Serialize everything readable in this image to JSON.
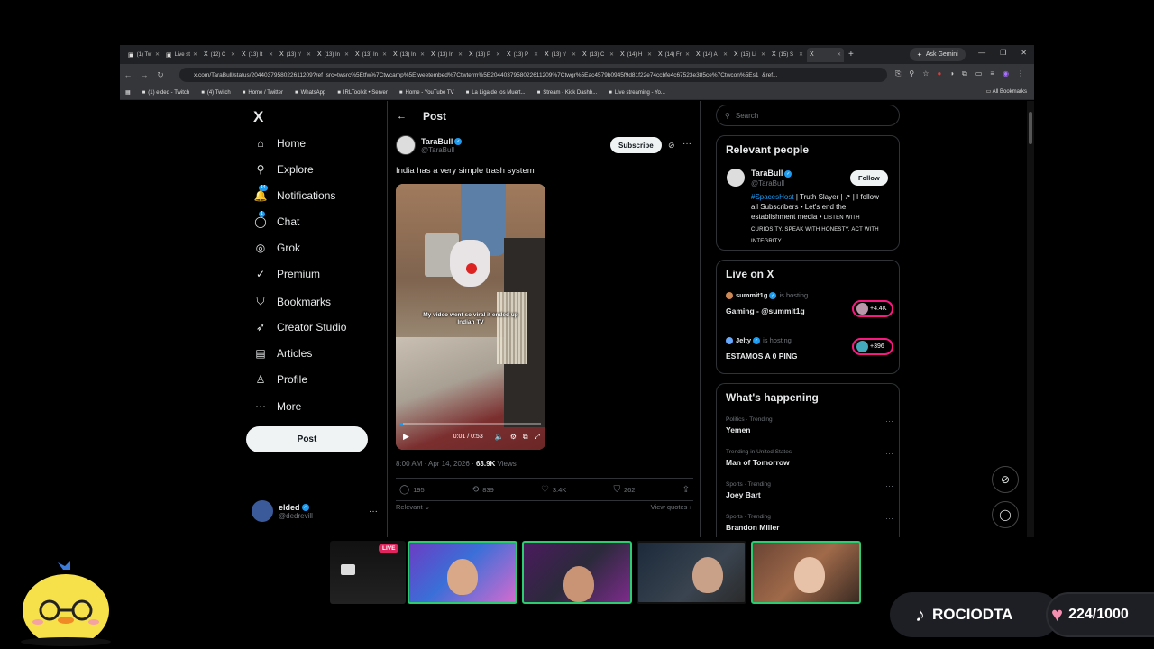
{
  "browser": {
    "tabs": [
      {
        "label": "(1) Tw",
        "active": false
      },
      {
        "label": "Live st",
        "active": false
      },
      {
        "label": "(12) C",
        "active": false
      },
      {
        "label": "(13) It",
        "active": false
      },
      {
        "label": "(13) r/",
        "active": false
      },
      {
        "label": "(13) In",
        "active": false
      },
      {
        "label": "(13) In",
        "active": false
      },
      {
        "label": "(13) In",
        "active": false
      },
      {
        "label": "(13) In",
        "active": false
      },
      {
        "label": "(13) P",
        "active": false
      },
      {
        "label": "(13) P",
        "active": false
      },
      {
        "label": "(13) r/",
        "active": false
      },
      {
        "label": "(13) C",
        "active": false
      },
      {
        "label": "(14) H",
        "active": false
      },
      {
        "label": "(14) Fr",
        "active": false
      },
      {
        "label": "(14) A",
        "active": false
      },
      {
        "label": "(15) Li",
        "active": false
      },
      {
        "label": "(15) S",
        "active": false
      },
      {
        "label": "",
        "active": true
      }
    ],
    "ask_gemini": "Ask Gemini",
    "url": "x.com/TaraBull/status/2044037958022611209?ref_src=twsrc%5Etfw%7Ctwcamp%5Etweetembed%7Ctwterm%5E2044037958022611209%7Ctwgr%5Eac4579b0945f9d81f22e74ccbfe4c67523e385ce%7Ctwcon%5Es1_&ref...",
    "bookmarks": [
      "(1) elded - Twitch",
      "(4) Twitch",
      "Home / Twitter",
      "WhatsApp",
      "IRLToolkit • Server",
      "Home - YouTube TV",
      "La Liga de los Muert...",
      "Stream - Kick Dashb...",
      "Live streaming - Yo..."
    ],
    "all_bookmarks": "All Bookmarks"
  },
  "nav": {
    "logo": "X",
    "items": [
      {
        "label": "Home",
        "icon": "⌂"
      },
      {
        "label": "Explore",
        "icon": "⚲"
      },
      {
        "label": "Notifications",
        "icon": "🔔",
        "badge": "14"
      },
      {
        "label": "Chat",
        "icon": "◯",
        "badge": "1"
      },
      {
        "label": "Grok",
        "icon": "◎"
      },
      {
        "label": "Premium",
        "icon": "✓"
      },
      {
        "label": "Bookmarks",
        "icon": "⛉"
      },
      {
        "label": "Creator Studio",
        "icon": "➶"
      },
      {
        "label": "Articles",
        "icon": "▤"
      },
      {
        "label": "Profile",
        "icon": "♙"
      },
      {
        "label": "More",
        "icon": "⋯"
      }
    ],
    "post_button": "Post",
    "account": {
      "name": "elded",
      "handle": "@dedrevill",
      "more": "···"
    }
  },
  "post": {
    "header_title": "Post",
    "author_name": "TaraBull",
    "author_handle": "@TaraBull",
    "subscribe_label": "Subscribe",
    "text": "India has a very simple trash system",
    "video": {
      "caption": "My video went so viral it ended up Indian TV",
      "time": "0:01 / 0:53",
      "progress": 0.02
    },
    "timestamp": "8:00 AM · Apr 14, 2026 · ",
    "views_count": "63.9K",
    "views_label": " Views",
    "replies": "195",
    "reposts": "839",
    "likes": "3.4K",
    "bookmarks": "262",
    "sort_label": "Relevant",
    "view_quotes": "View quotes"
  },
  "sidebar": {
    "search_placeholder": "Search",
    "relevant_title": "Relevant people",
    "relevant": {
      "name": "TaraBull",
      "handle": "@TaraBull",
      "follow_label": "Follow",
      "bio_tag": "#SpacesHost",
      "bio_main": " | Truth Slayer | ↗ | I follow all Subscribers • Let's end the establishment media • ",
      "bio_small": "LISTEN WITH CURIOSITY. SPEAK WITH HONESTY. ACT WITH INTEGRITY."
    },
    "live_title": "Live on X",
    "live": [
      {
        "host": "summit1g",
        "hosting": "is hosting",
        "title": "Gaming - @summit1g",
        "count": "+4.4K"
      },
      {
        "host": "Jelty",
        "hosting": "is hosting",
        "title": "ESTAMOS A 0 PING",
        "count": "+396"
      }
    ],
    "happening_title": "What's happening",
    "trends": [
      {
        "category": "Politics · Trending",
        "name": "Yemen"
      },
      {
        "category": "Trending in United States",
        "name": "Man of Tomorrow"
      },
      {
        "category": "Sports · Trending",
        "name": "Joey Bart"
      },
      {
        "category": "Sports · Trending",
        "name": "Brandon Miller"
      }
    ]
  },
  "overlay": {
    "live_badge": "LIVE",
    "tiktok_name": "ROCIODTA",
    "like_counter": "224/1000"
  },
  "colors": {
    "accent": "#1d9bf0",
    "live_pink": "#f91880",
    "cam_border": "#2ecc71"
  }
}
